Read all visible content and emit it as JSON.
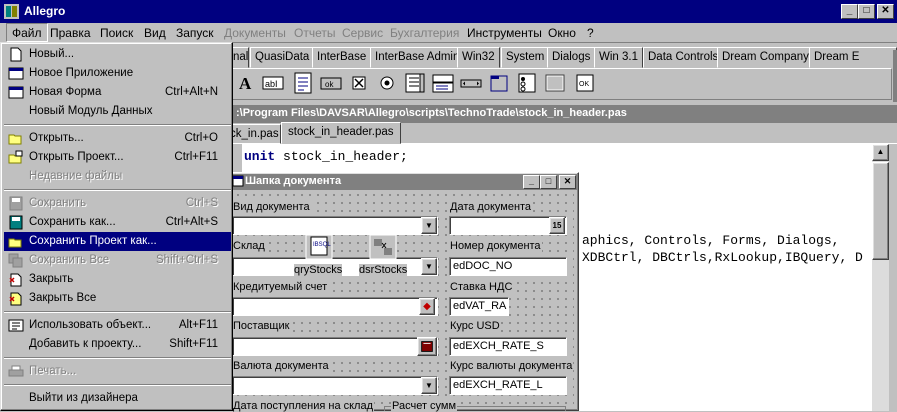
{
  "app": {
    "title": "Allegro"
  },
  "titlebar_buttons": {
    "minimize": "_",
    "maximize": "□",
    "close": "✕"
  },
  "menubar": [
    {
      "label": "Файл",
      "state": "open"
    },
    {
      "label": "Правка",
      "state": "normal"
    },
    {
      "label": "Поиск",
      "state": "normal"
    },
    {
      "label": "Вид",
      "state": "normal"
    },
    {
      "label": "Запуск",
      "state": "normal"
    },
    {
      "label": "Документы",
      "state": "disabled"
    },
    {
      "label": "Отчеты",
      "state": "disabled"
    },
    {
      "label": "Сервис",
      "state": "disabled"
    },
    {
      "label": "Бухгалтерия",
      "state": "disabled"
    },
    {
      "label": "Инструменты",
      "state": "normal"
    },
    {
      "label": "Окно",
      "state": "normal"
    },
    {
      "label": "?",
      "state": "normal"
    }
  ],
  "palette_tabs": [
    "nal",
    "QuasiData",
    "InterBase",
    "InterBase Admin",
    "Win32",
    "System",
    "Dialogs",
    "Win 3.1",
    "Data Controls",
    "Dream Company",
    "Dream E"
  ],
  "palette_icon_names": [
    "label-a-icon",
    "edit-abl-icon",
    "memo-icon",
    "button-ok-icon",
    "checkbox-x-icon",
    "radio-icon",
    "listbox-icon",
    "combobox-icon",
    "scrollbar-icon",
    "groupbox-icon",
    "radiogroup-icon",
    "panel-icon",
    "actionlist-icon"
  ],
  "file_menu": {
    "items": [
      {
        "label": "Новый...",
        "shortcut": "",
        "state": "normal",
        "icon": "new-icon"
      },
      {
        "label": "Новое Приложение",
        "shortcut": "",
        "state": "normal",
        "icon": "new-app-icon"
      },
      {
        "label": "Новая Форма",
        "shortcut": "Ctrl+Alt+N",
        "state": "normal",
        "icon": "new-form-icon"
      },
      {
        "label": "Новый Модуль Данных",
        "shortcut": "",
        "state": "normal",
        "icon": ""
      },
      {
        "separator": true
      },
      {
        "label": "Открыть...",
        "shortcut": "Ctrl+O",
        "state": "normal",
        "icon": "open-folder-icon"
      },
      {
        "label": "Открыть Проект...",
        "shortcut": "Ctrl+F11",
        "state": "normal",
        "icon": "open-project-icon"
      },
      {
        "label": "Недавние файлы",
        "shortcut": "",
        "state": "disabled",
        "icon": ""
      },
      {
        "separator": true
      },
      {
        "label": "Сохранить",
        "shortcut": "Ctrl+S",
        "state": "disabled",
        "icon": "save-icon"
      },
      {
        "label": "Сохранить как...",
        "shortcut": "Ctrl+Alt+S",
        "state": "normal",
        "icon": "save-as-icon"
      },
      {
        "label": "Сохранить Проект как...",
        "shortcut": "",
        "state": "highlighted",
        "icon": "save-project-icon"
      },
      {
        "label": "Сохранить Все",
        "shortcut": "Shift+Ctrl+S",
        "state": "disabled",
        "icon": "save-all-icon"
      },
      {
        "label": "Закрыть",
        "shortcut": "",
        "state": "normal",
        "icon": "close-file-icon"
      },
      {
        "label": "Закрыть Все",
        "shortcut": "",
        "state": "normal",
        "icon": "close-all-icon"
      },
      {
        "separator": true
      },
      {
        "label": "Использовать объект...",
        "shortcut": "Alt+F11",
        "state": "normal",
        "icon": "use-unit-icon"
      },
      {
        "label": "Добавить к проекту...",
        "shortcut": "Shift+F11",
        "state": "normal",
        "icon": ""
      },
      {
        "separator": true
      },
      {
        "label": "Печать...",
        "shortcut": "",
        "state": "disabled",
        "icon": "print-icon"
      },
      {
        "separator": true
      },
      {
        "label": "Выйти из дизайнера",
        "shortcut": "",
        "state": "normal",
        "icon": ""
      }
    ]
  },
  "editor": {
    "title": ":\\Program Files\\DAVSAR\\Allegro\\scripts\\TechnoTrade\\stock_in_header.pas",
    "tabs": [
      {
        "label": "ck_in.pas",
        "active": false
      },
      {
        "label": "stock_in_header.pas",
        "active": true
      }
    ],
    "code_keyword": "unit",
    "code_line1_rest": " stock_in_header;",
    "code_line2": "aphics, Controls, Forms, Dialogs,",
    "code_line3": "XDBCtrl, DBCtrls,RxLookup,IBQuery, D"
  },
  "form": {
    "title": "Шапка документа",
    "labels": {
      "doc_type": "Вид документа",
      "doc_date": "Дата документа",
      "warehouse": "Склад",
      "doc_number": "Номер документа",
      "credit_account": "Кредитуемый счет",
      "vat_rate": "Ставка НДС",
      "supplier": "Поставщик",
      "usd_rate": "Курс USD",
      "doc_currency": "Валюта документа",
      "doc_currency_rate": "Курс валюты документа",
      "arrival_date": "Дата поступления на склад",
      "calc_sums": "Расчет сумм"
    },
    "fields": {
      "doc_number": "edDOC_NO",
      "vat_rate": "edVAT_RA",
      "usd_rate": "edEXCH_RATE_S",
      "currency_rate": "edEXCH_RATE_L",
      "date_btn": "15"
    },
    "components": {
      "query": "qryStocks",
      "datasource": "dsrStocks",
      "query_badge": "IBSQL"
    }
  },
  "colors": {
    "title_active": "#000080",
    "title_inactive": "#808080",
    "face": "#c0c0c0",
    "highlight": "#000080"
  }
}
